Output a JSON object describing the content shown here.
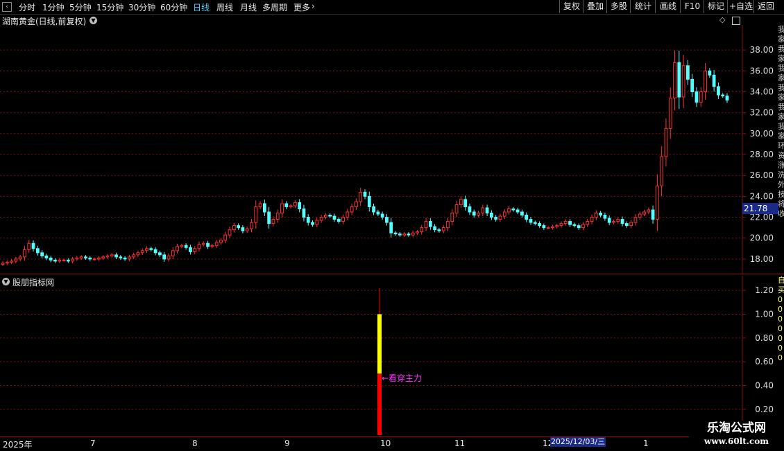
{
  "toolbar": {
    "periods": [
      "分时",
      "1分钟",
      "5分钟",
      "15分钟",
      "30分钟",
      "60分钟",
      "日线",
      "周线",
      "月线",
      "多周期",
      "更多"
    ],
    "active_period": "日线",
    "right_buttons": [
      "复权",
      "叠加",
      "多股",
      "统计",
      "画线",
      "F10",
      "标记",
      "+自选",
      "返回"
    ]
  },
  "main_chart": {
    "title": "湖南黄金(日线,前复权)",
    "current_price": "21.78",
    "y_ticks": [
      "38.00",
      "36.00",
      "34.00",
      "32.00",
      "30.00",
      "28.00",
      "26.00",
      "24.00",
      "22.00",
      "20.00",
      "18.00"
    ],
    "right_strip_text": "我家我家我家我家我家我家环资涨洗外技将收"
  },
  "indicator": {
    "title": "股朋指标网",
    "y_ticks": [
      "1.20",
      "1.00",
      "0.80",
      "0.60",
      "0.40",
      "0.20"
    ],
    "signal_label": "←看穿主力",
    "right_strip_text": "自买0000000"
  },
  "x_axis": {
    "labels": [
      "2025年",
      "7",
      "8",
      "9",
      "10",
      "11",
      "12",
      "1"
    ],
    "cursor_date": "2025/12/03/三"
  },
  "watermark": {
    "title": "乐淘公式网",
    "url": "www.60lt.com"
  },
  "colors": {
    "up": "#ff3232",
    "down": "#54ffff",
    "grid": "#7a1010",
    "signal_yellow": "#ffff00",
    "signal_red": "#ff0000",
    "label_magenta": "#ff33ff"
  },
  "chart_data": [
    {
      "type": "candlestick",
      "title": "湖南黄金(日线,前复权)",
      "ylim": [
        16.8,
        40.0
      ],
      "x": [
        "2025-06",
        "2025-07",
        "2025-08",
        "2025-09",
        "2025-10",
        "2025-11",
        "2025-12",
        "2026-01"
      ],
      "close_series": [
        17.6,
        17.7,
        17.8,
        18.0,
        18.2,
        18.9,
        19.5,
        19.0,
        18.6,
        18.3,
        18.1,
        17.9,
        17.8,
        17.9,
        17.9,
        17.8,
        18.0,
        18.1,
        18.2,
        18.1,
        18.0,
        18.0,
        18.1,
        18.2,
        18.3,
        18.4,
        18.2,
        18.1,
        18.0,
        18.2,
        18.4,
        18.6,
        18.8,
        19.0,
        18.9,
        18.6,
        18.4,
        18.0,
        18.3,
        18.8,
        19.2,
        19.3,
        19.1,
        18.7,
        19.0,
        19.4,
        19.5,
        19.2,
        19.3,
        19.6,
        19.8,
        20.3,
        20.8,
        21.2,
        21.0,
        20.7,
        20.9,
        21.5,
        23.0,
        23.3,
        22.5,
        21.4,
        21.8,
        22.4,
        23.3,
        23.0,
        23.1,
        23.4,
        22.8,
        22.0,
        21.5,
        21.3,
        21.7,
        22.0,
        22.2,
        22.1,
        21.8,
        21.6,
        22.0,
        22.5,
        23.0,
        23.5,
        24.4,
        24.0,
        23.0,
        22.5,
        22.3,
        22.0,
        21.5,
        20.5,
        20.4,
        20.3,
        20.4,
        20.3,
        20.5,
        20.6,
        21.0,
        21.6,
        21.1,
        20.8,
        20.7,
        21.0,
        21.6,
        22.4,
        23.2,
        23.7,
        23.0,
        22.5,
        22.2,
        22.4,
        22.9,
        22.4,
        22.0,
        21.8,
        22.1,
        22.5,
        22.8,
        22.7,
        22.5,
        22.2,
        21.8,
        21.5,
        21.4,
        21.2,
        21.0,
        21.0,
        21.1,
        21.2,
        21.4,
        21.6,
        21.3,
        21.2,
        21.0,
        21.3,
        21.6,
        22.0,
        22.4,
        22.2,
        21.9,
        21.5,
        21.6,
        21.8,
        21.4,
        21.2,
        21.5,
        22.0,
        22.3,
        22.5,
        22.7,
        21.8,
        25.0,
        27.8,
        30.5,
        33.4,
        36.8,
        33.5,
        36.5,
        35.2,
        34.0,
        33.0,
        34.0,
        36.0,
        35.6,
        34.5,
        33.7,
        33.6,
        33.2
      ]
    },
    {
      "type": "bar",
      "title": "股朋指标网",
      "ylim": [
        0.1,
        1.3
      ],
      "x": [
        "2025-10-09"
      ],
      "series": [
        {
          "values": [
            1.0
          ]
        },
        {
          "values": [
            0.5
          ]
        }
      ],
      "annotations": [
        "←看穿主力"
      ]
    }
  ]
}
